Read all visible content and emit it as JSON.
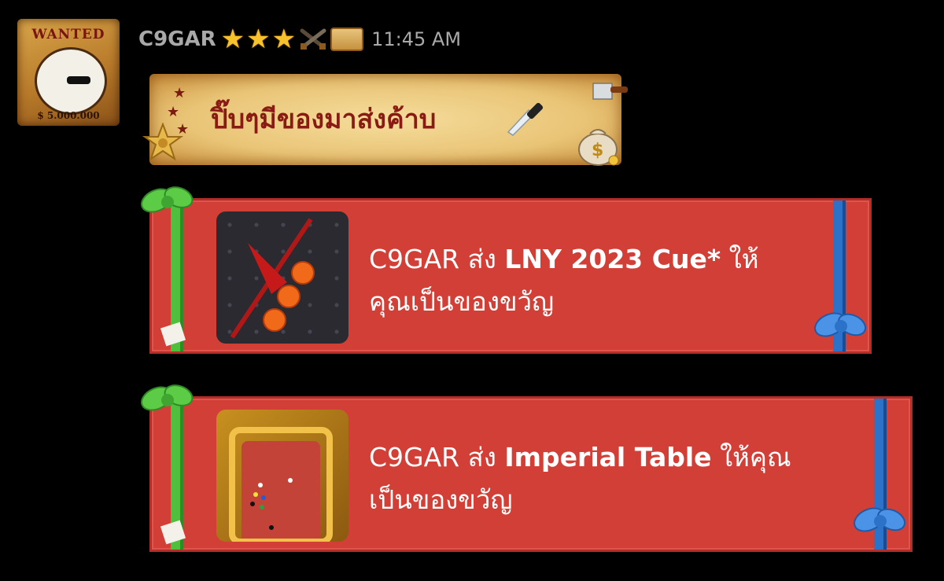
{
  "avatar": {
    "wanted_text": "WANTED",
    "bounty": "$ 5.000.000"
  },
  "header": {
    "username": "C9GAR",
    "stars": [
      "★",
      "★",
      "★"
    ],
    "badge_icons": [
      "crossed-guns-icon",
      "scroll-icon"
    ],
    "timestamp": "11:45 AM"
  },
  "parchment_message": {
    "text": "ปิ๊บๆมีของมาส่งค้าบ"
  },
  "gifts": [
    {
      "sender": "C9GAR",
      "verb": "ส่ง",
      "item": "LNY 2023 Cue*",
      "suffix_line1": "ให้",
      "line2": "คุณเป็นของขวัญ",
      "thumbnail": "lny-cue-thumbnail"
    },
    {
      "sender": "C9GAR",
      "verb": "ส่ง",
      "item": "Imperial Table",
      "suffix_line1": "ให้คุณ",
      "line2": "เป็นของขวัญ",
      "thumbnail": "imperial-table-thumbnail"
    }
  ],
  "colors": {
    "background": "#000000",
    "gift_red": "#d23f37",
    "ribbon_green": "#4fbf3d",
    "ribbon_blue": "#2d72c9",
    "parchment_text": "#8a1a14",
    "star_gold": "#f7c22b",
    "meta_gray": "#a9a9a9"
  }
}
